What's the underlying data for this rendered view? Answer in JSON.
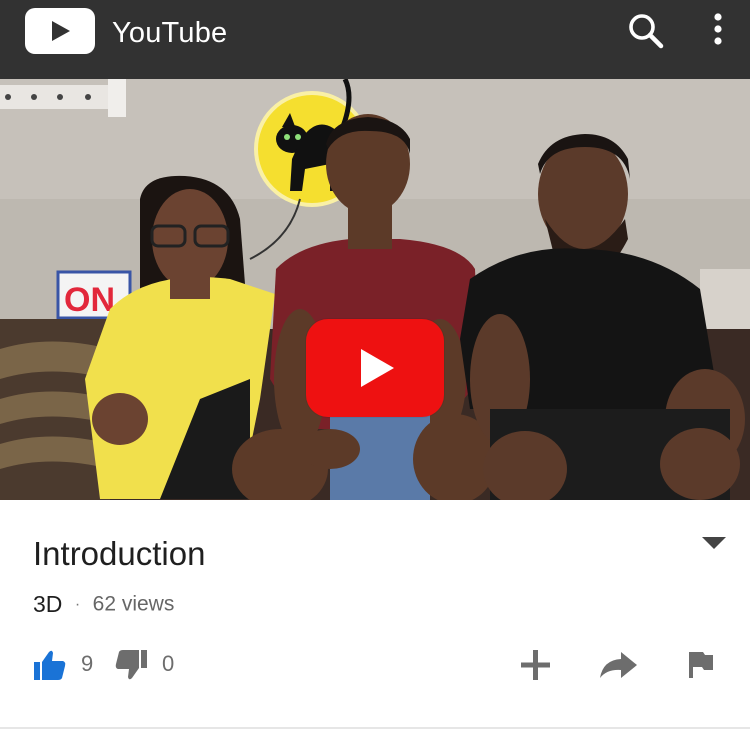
{
  "app_bar": {
    "title": "YouTube",
    "logo_icon": "youtube-play-logo-icon",
    "search_icon": "search-icon",
    "more_icon": "more-vert-icon",
    "background": "#323232"
  },
  "player": {
    "play_icon": "play-icon",
    "play_button_color": "#ee1111",
    "sign_text": "ON"
  },
  "video": {
    "title": "Introduction",
    "channel": "3D",
    "separator": "·",
    "views": "62 views",
    "expand_icon": "expand-more-icon"
  },
  "actions": {
    "like_count": "9",
    "dislike_count": "0",
    "like_color": "#1a73d6",
    "icons": [
      "thumb-up-icon",
      "thumb-down-icon",
      "add-to-playlist-icon",
      "share-icon",
      "flag-icon"
    ]
  }
}
